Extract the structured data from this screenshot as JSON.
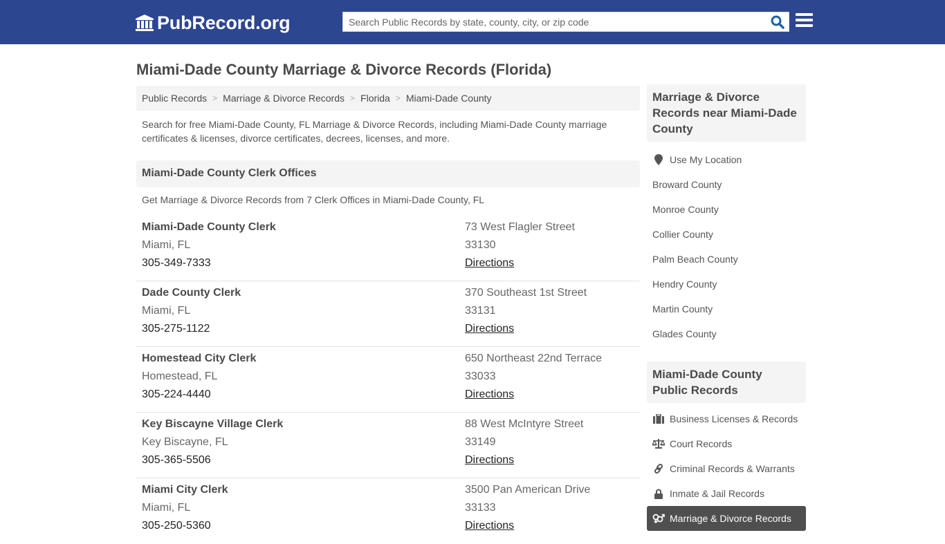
{
  "header": {
    "logo_text": "PubRecord.org",
    "search_placeholder": "Search Public Records by state, county, city, or zip code",
    "search_value": ""
  },
  "page": {
    "title": "Miami-Dade County Marriage & Divorce Records (Florida)",
    "breadcrumb": [
      "Public Records",
      "Marriage & Divorce Records",
      "Florida",
      "Miami-Dade County"
    ],
    "intro": "Search for free Miami-Dade County, FL Marriage & Divorce Records, including Miami-Dade County marriage certificates & licenses, divorce certificates, decrees, licenses, and more.",
    "section_title": "Miami-Dade County Clerk Offices",
    "section_intro": "Get Marriage & Divorce Records from 7 Clerk Offices in Miami-Dade County, FL"
  },
  "offices": [
    {
      "name": "Miami-Dade County Clerk",
      "city": "Miami, FL",
      "phone": "305-349-7333",
      "address": "73 West Flagler Street",
      "zip": "33130",
      "directions": "Directions"
    },
    {
      "name": "Dade County Clerk",
      "city": "Miami, FL",
      "phone": "305-275-1122",
      "address": "370 Southeast 1st Street",
      "zip": "33131",
      "directions": "Directions"
    },
    {
      "name": "Homestead City Clerk",
      "city": "Homestead, FL",
      "phone": "305-224-4440",
      "address": "650 Northeast 22nd Terrace",
      "zip": "33033",
      "directions": "Directions"
    },
    {
      "name": "Key Biscayne Village Clerk",
      "city": "Key Biscayne, FL",
      "phone": "305-365-5506",
      "address": "88 West McIntyre Street",
      "zip": "33149",
      "directions": "Directions"
    },
    {
      "name": "Miami City Clerk",
      "city": "Miami, FL",
      "phone": "305-250-5360",
      "address": "3500 Pan American Drive",
      "zip": "33133",
      "directions": "Directions"
    }
  ],
  "sidebar": {
    "nearby_title": "Marriage & Divorce Records near Miami-Dade County",
    "use_location": "Use My Location",
    "nearby": [
      "Broward County",
      "Monroe County",
      "Collier County",
      "Palm Beach County",
      "Hendry County",
      "Martin County",
      "Glades County"
    ],
    "public_title": "Miami-Dade County Public Records",
    "categories": [
      {
        "label": "Business Licenses & Records",
        "icon": "briefcase-icon"
      },
      {
        "label": "Court Records",
        "icon": "scale-icon"
      },
      {
        "label": "Criminal Records & Warrants",
        "icon": "link-icon"
      },
      {
        "label": "Inmate & Jail Records",
        "icon": "lock-icon"
      },
      {
        "label": "Marriage & Divorce Records",
        "icon": "venus-mars-icon",
        "active": true
      }
    ]
  },
  "colors": {
    "header_bg": "#2d4690",
    "search_icon": "#1f5fa8",
    "panel_bg": "#f4f4f4",
    "active_item_bg": "#4f4f4f"
  }
}
